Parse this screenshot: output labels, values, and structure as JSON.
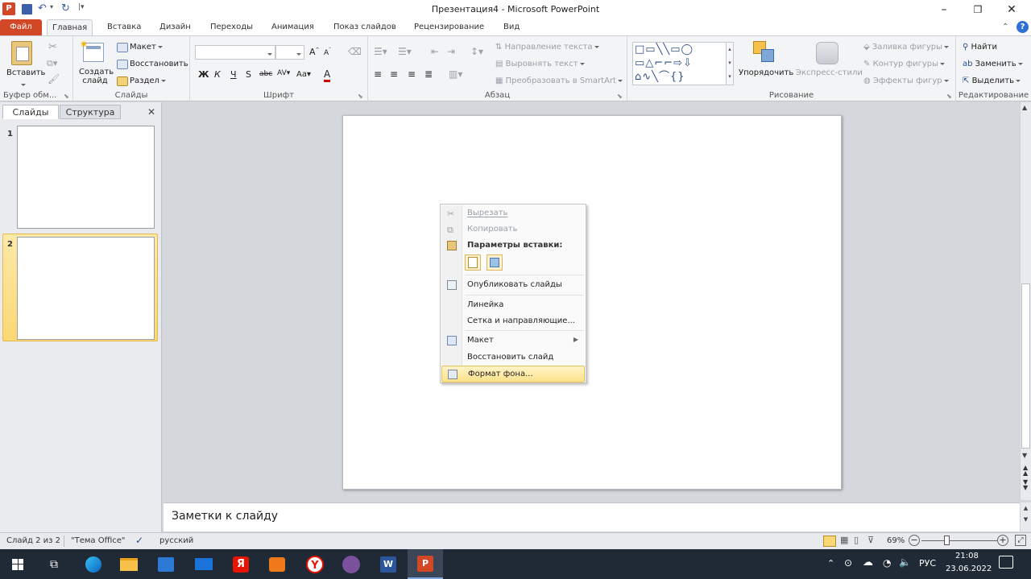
{
  "window": {
    "title": "Презентация4 - Microsoft PowerPoint"
  },
  "tabs": [
    "Файл",
    "Главная",
    "Вставка",
    "Дизайн",
    "Переходы",
    "Анимация",
    "Показ слайдов",
    "Рецензирование",
    "Вид"
  ],
  "ribbon": {
    "clipboard": {
      "paste_label": "Вставить",
      "group_label": "Буфер обм..."
    },
    "slides": {
      "new_slide_label": "Создать слайд",
      "layout_label": "Макет",
      "reset_label": "Восстановить",
      "section_label": "Раздел",
      "group_label": "Слайды"
    },
    "font": {
      "group_label": "Шрифт"
    },
    "paragraph": {
      "text_direction": "Направление текста",
      "align_text": "Выровнять текст",
      "smartart": "Преобразовать в SmartArt",
      "group_label": "Абзац"
    },
    "drawing": {
      "arrange_label": "Упорядочить",
      "quick_styles_label": "Экспресс-стили",
      "fill_label": "Заливка фигуры",
      "outline_label": "Контур фигуры",
      "effects_label": "Эффекты фигур",
      "group_label": "Рисование"
    },
    "editing": {
      "find_label": "Найти",
      "replace_label": "Заменить",
      "select_label": "Выделить",
      "group_label": "Редактирование"
    }
  },
  "left_panel": {
    "tab_slides": "Слайды",
    "tab_outline": "Структура",
    "slide_numbers": [
      "1",
      "2"
    ]
  },
  "context_menu": {
    "cut": "Вырезать",
    "copy": "Копировать",
    "paste_options": "Параметры вставки:",
    "publish": "Опубликовать слайды",
    "ruler": "Линейка",
    "grid": "Сетка и направляющие...",
    "layout": "Макет",
    "reset_slide": "Восстановить слайд",
    "format_background": "Формат фона..."
  },
  "notes": {
    "placeholder": "Заметки к слайду"
  },
  "status": {
    "slide_info": "Слайд 2 из 2",
    "theme": "\"Тема Office\"",
    "language": "русский",
    "zoom": "69%"
  },
  "taskbar": {
    "language": "РУС",
    "time": "21:08",
    "date": "23.06.2022"
  },
  "colors": {
    "accent": "#d24726",
    "selection": "#fbd873"
  }
}
